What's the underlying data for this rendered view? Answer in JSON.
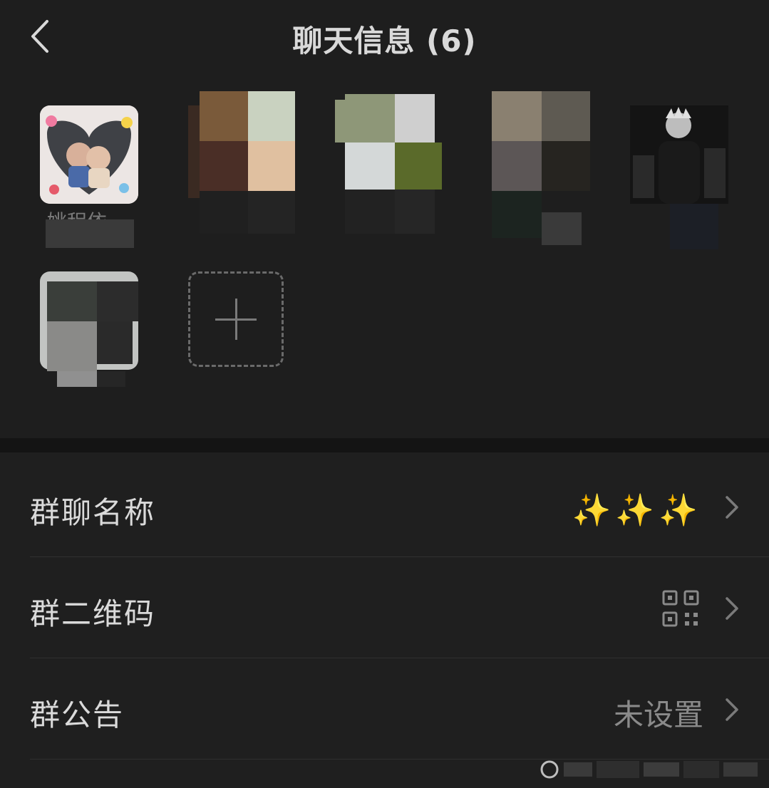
{
  "header": {
    "title": "聊天信息 (6)",
    "back_icon": "chevron-left-icon"
  },
  "members": {
    "first_member_name": "姚程依",
    "add_icon": "plus-icon"
  },
  "settings": {
    "group_name": {
      "label": "群聊名称",
      "value": "✨✨✨"
    },
    "group_qr": {
      "label": "群二维码",
      "icon": "qr-code-icon"
    },
    "group_notice": {
      "label": "群公告",
      "value": "未设置"
    }
  },
  "colors": {
    "background": "#1e1e1e",
    "text": "#dadada",
    "secondary_text": "#8a8a8a",
    "sparkle": "#f2c94c"
  }
}
